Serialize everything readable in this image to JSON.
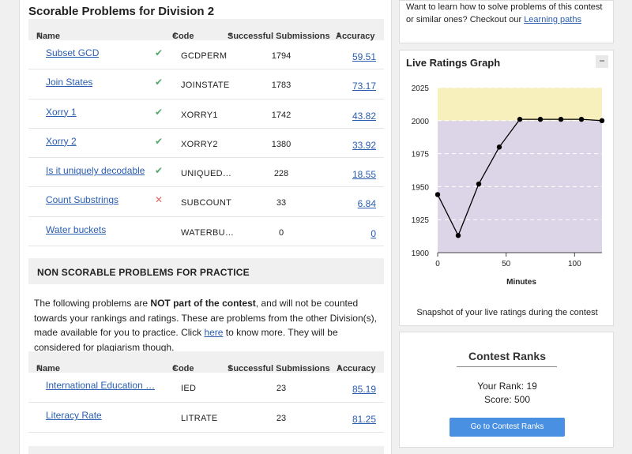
{
  "scorable": {
    "title": "Scorable Problems for Division 2",
    "headers": {
      "name": "Name",
      "code": "Code",
      "subs": "Successful Submissions",
      "acc": "Accuracy"
    },
    "rows": [
      {
        "name": "Subset GCD",
        "status": "✔",
        "code": "GCDPERM",
        "subs": "1794",
        "acc": "59.51"
      },
      {
        "name": "Join States",
        "status": "✔",
        "code": "JOINSTATE",
        "subs": "1783",
        "acc": "73.17"
      },
      {
        "name": "Xorry 1",
        "status": "✔",
        "code": "XORRY1",
        "subs": "1742",
        "acc": "43.82"
      },
      {
        "name": "Xorry 2",
        "status": "✔",
        "code": "XORRY2",
        "subs": "1380",
        "acc": "33.92"
      },
      {
        "name": "Is it uniquely decodable",
        "status": "✔",
        "code": "UNIQUED…",
        "subs": "228",
        "acc": "18.55"
      },
      {
        "name": "Count Substrings",
        "status": "✕",
        "code": "SUBCOUNT",
        "subs": "33",
        "acc": "6.84"
      },
      {
        "name": "Water buckets",
        "status": "",
        "code": "WATERBU…",
        "subs": "0",
        "acc": "0"
      }
    ]
  },
  "nonscorable": {
    "title": "NON SCORABLE PROBLEMS FOR PRACTICE",
    "p1": "The following problems are ",
    "p_bold1": "NOT part of the contest",
    "p2": ", and will not be counted towards your rankings and ratings. These are problems from the other Division(s), made available for you to practice. Click ",
    "p_link": "here",
    "p3": " to know more. They will be considered for plagiarism though.",
    "headers": {
      "name": "Name",
      "code": "Code",
      "subs": "Successful Submissions",
      "acc": "Accuracy"
    },
    "rows": [
      {
        "name": "International Education …",
        "code": "IED",
        "subs": "23",
        "acc": "85.19"
      },
      {
        "name": "Literacy Rate",
        "code": "LITRATE",
        "subs": "23",
        "acc": "81.25"
      }
    ]
  },
  "learn": {
    "text": "Want to learn how to solve problems of this contest or similar ones? Checkout our ",
    "link": "Learning paths"
  },
  "graph": {
    "title": "Live Ratings Graph",
    "collapse": "−",
    "caption": "Snapshot of your live ratings during the contest"
  },
  "chart_data": {
    "type": "line",
    "xlabel": "Minutes",
    "ylabel": "",
    "xlim": [
      0,
      120
    ],
    "ylim": [
      1900,
      2025
    ],
    "xticks": [
      0,
      50,
      100
    ],
    "yticks": [
      1900,
      1925,
      1950,
      1975,
      2000,
      2025
    ],
    "bands": [
      {
        "from": 1900,
        "to": 2000,
        "color": "#dcd5e8"
      },
      {
        "from": 2000,
        "to": 2025,
        "color": "#f7efbc"
      }
    ],
    "line_color": "#000000",
    "x": [
      0,
      15,
      30,
      45,
      60,
      75,
      90,
      105,
      120
    ],
    "y": [
      1944,
      1913,
      1952,
      1980,
      2001,
      2001,
      2001,
      2001,
      2000
    ]
  },
  "ranks": {
    "title": "Contest Ranks",
    "rank": "Your Rank: 19",
    "score": "Score: 500",
    "button": "Go to Contest Ranks"
  }
}
